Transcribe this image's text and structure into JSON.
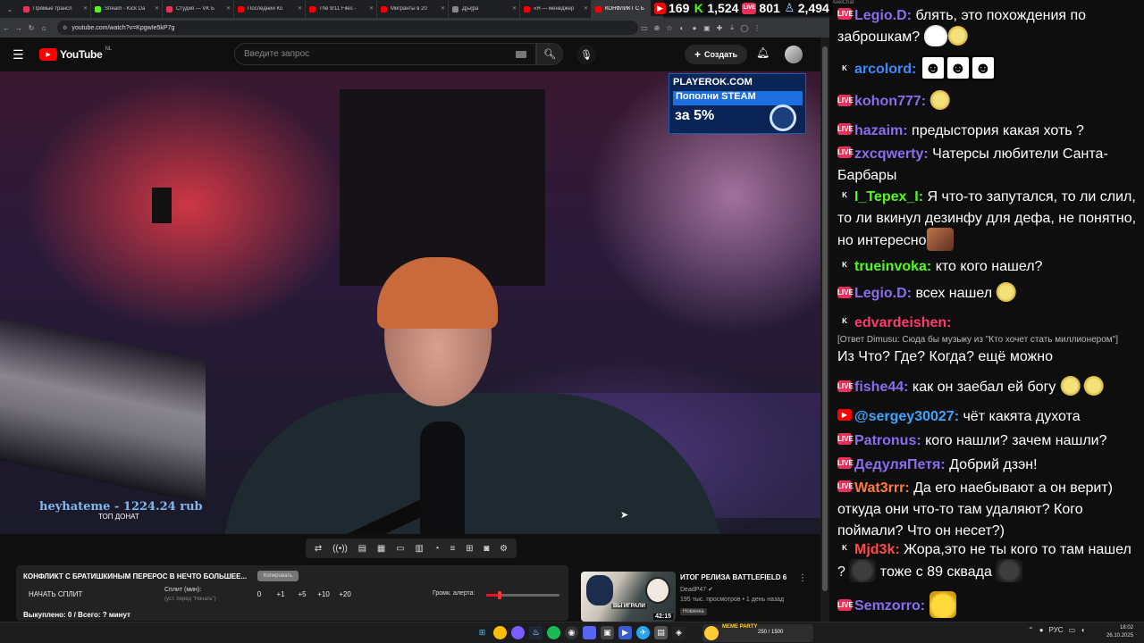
{
  "browser": {
    "tabs": [
      {
        "label": "Прямые трансл",
        "color": "#e8305a"
      },
      {
        "label": "Stream - Kick Da",
        "color": "#53fc18"
      },
      {
        "label": "Студия — VK Б",
        "color": "#e8305a"
      },
      {
        "label": "Последний Ко",
        "color": "#ff0000"
      },
      {
        "label": "The 9/11 Files -",
        "color": "#ff0000"
      },
      {
        "label": "Мигранты в 20",
        "color": "#ff0000"
      },
      {
        "label": "Д[ы]ра",
        "color": "#888888"
      },
      {
        "label": "«Я — менеджер",
        "color": "#ff0000"
      },
      {
        "label": "КОНФЛИКТ С Б",
        "color": "#ff0000"
      }
    ],
    "url": "youtube.com/watch?v=KpgwIe5kP7g"
  },
  "stats": {
    "youtube": "169",
    "kick": "1,524",
    "vk": "801",
    "total": "2,494"
  },
  "youtube": {
    "logo_text": "YouTube",
    "region": "NL",
    "search_placeholder": "Введите запрос",
    "create_label": "Создать"
  },
  "video": {
    "ad_line1": "PLAYEROK.COM",
    "ad_line2": "Пополни STEAM",
    "ad_line3": "за 5%",
    "top_donor": "heyhateme - 1224.24 rub",
    "top_donor_label": "ТОП ДОНАТ"
  },
  "panel": {
    "title": "КОНФЛИКТ С БРАТИШКИНЫМ ПЕРЕРОС В НЕЧТО БОЛЬШЕЕ...",
    "copy_label": "Копировать",
    "split_button": "НАЧАТЬ СПЛИТ",
    "split_label": "Сплит (мин):",
    "split_hint": "(уст. перед \"Начать\")",
    "split_values": [
      "0",
      "+1",
      "+5",
      "+10",
      "+20"
    ],
    "alert_label": "Громк. алерта:",
    "alert_level": 0.2,
    "bought": "Выкуплено: 0 / Всего: ? минут"
  },
  "recommendation": {
    "title": "ИТОГ РЕЛИЗА BATTLEFIELD 6",
    "channel": "DeadP47",
    "views": "195 тыс. просмотров • 1 день назад",
    "badge": "Новинка",
    "duration": "42:15",
    "thumb_caption": "ВЫ ИГРАЛИ"
  },
  "chat": {
    "title": "AxelChat",
    "messages": [
      {
        "platform": "vk",
        "nick": "Legio.D:",
        "color": "#8a6df0",
        "text": " блять, это похождения по заброшкам?"
      },
      {
        "platform": "kick",
        "nick": "arcolord:",
        "color": "#3b8dff",
        "text": ""
      },
      {
        "platform": "vk",
        "nick": "kohon777:",
        "color": "#8a6df0",
        "text": ""
      },
      {
        "platform": "vk",
        "nick": "hazaim:",
        "color": "#8a6df0",
        "text": " предыстория какая хоть ?"
      },
      {
        "platform": "vk",
        "nick": "zxcqwerty:",
        "color": "#8a6df0",
        "text": " Чатерсы любители Санта-Барбары"
      },
      {
        "platform": "kick",
        "nick": "I_Tepex_I:",
        "color": "#53fc18",
        "text": " Я что-то запутался, то ли слил, то ли вкинул дезинфу для дефа, не понятно, но интересно"
      },
      {
        "platform": "kick",
        "nick": "trueinvoka:",
        "color": "#53fc18",
        "text": " кто кого нашел?"
      },
      {
        "platform": "vk",
        "nick": "Legio.D:",
        "color": "#8a6df0",
        "text": " всех нашел"
      },
      {
        "platform": "kick",
        "nick": "edvardeishen:",
        "color": "#ff3a6e",
        "text": "",
        "reply": "[Ответ Dimusu: Сюда бы музыку из \"Кто хочет стать миллионером\"]",
        "text2": "Из Что? Где? Когда? ещё можно"
      },
      {
        "platform": "vk",
        "nick": "fishe44:",
        "color": "#8a6df0",
        "text": " как он заебал ей богу"
      },
      {
        "platform": "yt",
        "nick": "@sergey30027:",
        "color": "#3ea6ff",
        "text": " чёт какята духота"
      },
      {
        "platform": "vk",
        "nick": "Patronus:",
        "color": "#8a6df0",
        "text": " кого нашли? зачем нашли?"
      },
      {
        "platform": "vk",
        "nick": "ДедуляПетя:",
        "color": "#8a6df0",
        "text": " Добрий дзэн!"
      },
      {
        "platform": "vk",
        "nick": "Wat3rrr:",
        "color": "#ff7a3a",
        "text": " Да его наебывают а он верит) откуда они что-то там удаляют? Кого поймали? Что он несет?)"
      },
      {
        "platform": "kick",
        "nick": "Mjd3k:",
        "color": "#ff4a4a",
        "text": " Жора,это не ты кого то там нашел ?",
        "text2": " тоже с 89 сквада"
      },
      {
        "platform": "vk",
        "nick": "Semzorro:",
        "color": "#8a6df0",
        "text": ""
      }
    ]
  },
  "taskbar": {
    "meme_title": "MEME PARTY",
    "meme_progress": "250 / 1500",
    "lang": "РУС",
    "time": "18:02",
    "date": "26.10.2025"
  }
}
